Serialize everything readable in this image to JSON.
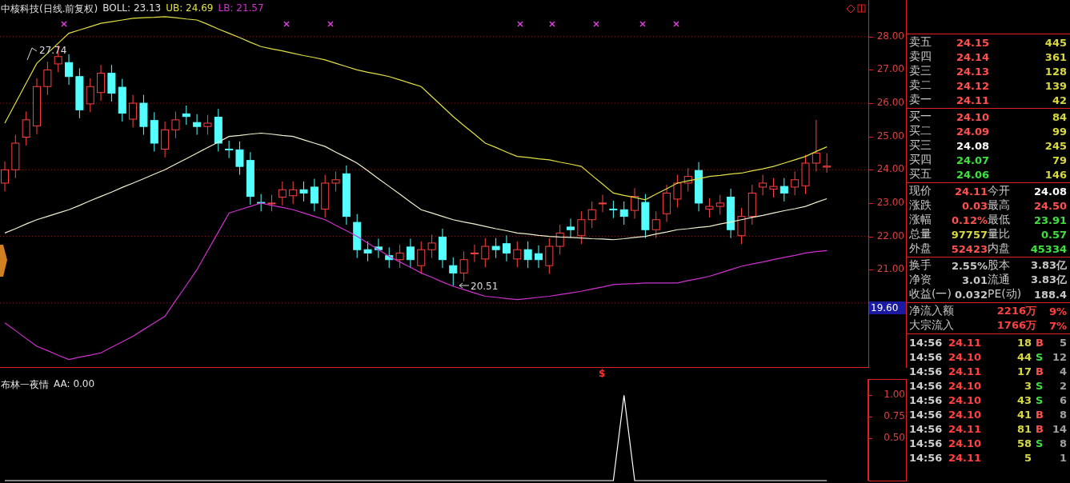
{
  "chart": {
    "stock": "中核科技(日线.前复权)",
    "boll": "BOLL: 23.13",
    "ub": "UB: 24.69",
    "lb": "LB: 21.57",
    "high_note": "27.74",
    "low_note": "20.51",
    "signal": "$",
    "chart_data": {
      "type": "candlestick",
      "ylim": [
        18.05,
        29.1
      ],
      "grid": true,
      "yticks": [
        {
          "value": 28,
          "label": "28.00"
        },
        {
          "value": 27,
          "label": "27.00"
        },
        {
          "value": 26,
          "label": "26.00"
        },
        {
          "value": 25,
          "label": "25.00"
        },
        {
          "value": 24,
          "label": "24.00"
        },
        {
          "value": 23,
          "label": "23.00"
        },
        {
          "value": 22,
          "label": "22.00"
        },
        {
          "value": 21,
          "label": "21.00"
        }
      ],
      "ohlc": [
        [
          23.6,
          24.25,
          23.35,
          24.0
        ],
        [
          24.0,
          25.05,
          23.75,
          24.8
        ],
        [
          24.98,
          25.75,
          24.73,
          25.5
        ],
        [
          25.32,
          26.75,
          25.07,
          26.5
        ],
        [
          26.5,
          27.25,
          26.25,
          27.0
        ],
        [
          27.18,
          27.74,
          26.93,
          27.4
        ],
        [
          27.22,
          27.47,
          26.55,
          26.8
        ],
        [
          26.8,
          27.05,
          25.55,
          25.8
        ],
        [
          25.98,
          26.75,
          25.73,
          26.5
        ],
        [
          26.32,
          27.15,
          26.07,
          26.9
        ],
        [
          26.9,
          27.15,
          26.05,
          26.3
        ],
        [
          26.48,
          26.73,
          25.45,
          25.7
        ],
        [
          25.52,
          26.25,
          25.27,
          26.0
        ],
        [
          26.0,
          26.25,
          25.05,
          25.3
        ],
        [
          25.48,
          25.73,
          24.55,
          24.8
        ],
        [
          24.62,
          25.45,
          24.37,
          25.2
        ],
        [
          25.2,
          25.75,
          24.95,
          25.5
        ],
        [
          25.68,
          25.93,
          25.35,
          25.6
        ],
        [
          25.42,
          25.67,
          25.05,
          25.3
        ],
        [
          25.3,
          25.65,
          25.05,
          25.4
        ],
        [
          25.58,
          25.83,
          24.55,
          24.8
        ],
        [
          24.62,
          24.87,
          24.35,
          24.6
        ],
        [
          24.6,
          24.85,
          23.85,
          24.1
        ],
        [
          24.28,
          24.53,
          22.95,
          23.2
        ],
        [
          23.02,
          23.27,
          22.75,
          23.0
        ],
        [
          23.0,
          23.25,
          22.75,
          23.0
        ],
        [
          23.18,
          23.65,
          22.93,
          23.4
        ],
        [
          23.22,
          23.65,
          22.97,
          23.4
        ],
        [
          23.4,
          23.65,
          23.05,
          23.3
        ],
        [
          23.48,
          23.73,
          22.75,
          23.0
        ],
        [
          22.82,
          23.85,
          22.57,
          23.6
        ],
        [
          23.6,
          23.95,
          23.35,
          23.7
        ],
        [
          23.88,
          24.13,
          22.35,
          22.6
        ],
        [
          22.42,
          22.67,
          21.35,
          21.6
        ],
        [
          21.6,
          21.85,
          21.25,
          21.5
        ],
        [
          21.68,
          21.93,
          21.35,
          21.6
        ],
        [
          21.42,
          21.67,
          21.05,
          21.3
        ],
        [
          21.3,
          21.75,
          21.05,
          21.5
        ],
        [
          21.68,
          21.93,
          21.05,
          21.3
        ],
        [
          21.12,
          21.85,
          20.87,
          21.6
        ],
        [
          21.6,
          22.05,
          21.35,
          21.8
        ],
        [
          21.98,
          22.23,
          21.05,
          21.3
        ],
        [
          21.12,
          21.37,
          20.51,
          20.9
        ],
        [
          20.9,
          21.55,
          20.65,
          21.3
        ],
        [
          21.48,
          21.75,
          21.23,
          21.5
        ],
        [
          21.32,
          21.95,
          21.07,
          21.7
        ],
        [
          21.7,
          21.95,
          21.35,
          21.6
        ],
        [
          21.78,
          22.03,
          21.25,
          21.5
        ],
        [
          21.32,
          21.85,
          21.07,
          21.6
        ],
        [
          21.6,
          21.85,
          21.05,
          21.3
        ],
        [
          21.48,
          21.73,
          21.05,
          21.3
        ],
        [
          21.12,
          21.95,
          20.87,
          21.7
        ],
        [
          21.7,
          22.35,
          21.45,
          22.1
        ],
        [
          22.28,
          22.53,
          21.95,
          22.2
        ],
        [
          22.02,
          22.75,
          21.77,
          22.5
        ],
        [
          22.5,
          23.05,
          22.25,
          22.8
        ],
        [
          22.98,
          23.25,
          22.73,
          23.0
        ],
        [
          22.82,
          23.07,
          22.55,
          22.8
        ],
        [
          22.8,
          23.05,
          22.35,
          22.6
        ],
        [
          22.78,
          23.45,
          22.53,
          23.2
        ],
        [
          23.02,
          23.27,
          21.95,
          22.2
        ],
        [
          22.2,
          22.75,
          21.95,
          22.5
        ],
        [
          22.68,
          23.55,
          22.43,
          23.3
        ],
        [
          23.12,
          23.85,
          22.87,
          23.6
        ],
        [
          23.6,
          24.05,
          23.35,
          23.8
        ],
        [
          23.98,
          24.23,
          22.75,
          23.0
        ],
        [
          22.82,
          23.15,
          22.57,
          22.9
        ],
        [
          22.9,
          23.25,
          22.65,
          23.0
        ],
        [
          23.18,
          23.43,
          21.95,
          22.2
        ],
        [
          22.02,
          22.85,
          21.77,
          22.6
        ],
        [
          22.6,
          23.55,
          22.35,
          23.3
        ],
        [
          23.48,
          23.85,
          23.23,
          23.6
        ],
        [
          23.42,
          23.75,
          23.17,
          23.5
        ],
        [
          23.5,
          23.75,
          23.05,
          23.3
        ],
        [
          23.48,
          23.95,
          23.23,
          23.7
        ],
        [
          23.52,
          24.45,
          23.27,
          24.2
        ],
        [
          24.2,
          25.5,
          23.95,
          24.5
        ],
        [
          24.08,
          24.5,
          23.91,
          24.11
        ]
      ],
      "series": [
        {
          "type": "line",
          "color": "#e0e040",
          "values": [
            25.4,
            26.0,
            26.6,
            27.2,
            27.5,
            27.8,
            28.1,
            28.2,
            28.3,
            28.4,
            28.45,
            28.5,
            28.55,
            28.57,
            28.58,
            28.6,
            28.57,
            28.53,
            28.5,
            28.37,
            28.23,
            28.1,
            27.97,
            27.83,
            27.7,
            27.63,
            27.57,
            27.5,
            27.43,
            27.37,
            27.3,
            27.2,
            27.1,
            27.0,
            26.93,
            26.87,
            26.8,
            26.7,
            26.6,
            26.5,
            26.2,
            25.9,
            25.6,
            25.33,
            25.07,
            24.8,
            24.67,
            24.53,
            24.4,
            24.37,
            24.33,
            24.3,
            24.23,
            24.17,
            24.1,
            23.83,
            23.57,
            23.3,
            23.23,
            23.17,
            23.1,
            23.27,
            23.43,
            23.6,
            23.67,
            23.73,
            23.8,
            23.83,
            23.87,
            23.9,
            23.97,
            24.03,
            24.1,
            24.2,
            24.3,
            24.4,
            24.55,
            24.69
          ]
        },
        {
          "type": "line",
          "color": "#f0f0d0",
          "values": [
            22.1,
            22.23,
            22.37,
            22.5,
            22.6,
            22.7,
            22.8,
            22.93,
            23.07,
            23.2,
            23.33,
            23.47,
            23.6,
            23.73,
            23.87,
            24.0,
            24.17,
            24.33,
            24.5,
            24.67,
            24.83,
            25.0,
            25.03,
            25.07,
            25.1,
            25.07,
            25.03,
            25.0,
            24.9,
            24.8,
            24.7,
            24.53,
            24.37,
            24.2,
            23.97,
            23.73,
            23.5,
            23.27,
            23.03,
            22.8,
            22.7,
            22.6,
            22.5,
            22.43,
            22.37,
            22.3,
            22.23,
            22.17,
            22.1,
            22.07,
            22.03,
            22.0,
            21.98,
            21.97,
            21.95,
            21.93,
            21.92,
            21.9,
            21.93,
            21.97,
            22.0,
            22.07,
            22.13,
            22.2,
            22.23,
            22.27,
            22.3,
            22.37,
            22.43,
            22.5,
            22.57,
            22.63,
            22.7,
            22.77,
            22.83,
            22.9,
            23.02,
            23.13
          ]
        },
        {
          "type": "line",
          "color": "#d030d0",
          "values": [
            19.4,
            19.17,
            18.93,
            18.7,
            18.57,
            18.43,
            18.3,
            18.37,
            18.43,
            18.5,
            18.67,
            18.83,
            19.0,
            19.2,
            19.4,
            19.6,
            20.07,
            20.53,
            21.0,
            21.57,
            22.13,
            22.7,
            22.8,
            22.9,
            23.0,
            22.93,
            22.87,
            22.8,
            22.7,
            22.6,
            22.5,
            22.33,
            22.17,
            22.0,
            21.8,
            21.6,
            21.4,
            21.23,
            21.07,
            20.9,
            20.77,
            20.63,
            20.5,
            20.4,
            20.3,
            20.2,
            20.17,
            20.13,
            20.1,
            20.13,
            20.17,
            20.2,
            20.25,
            20.3,
            20.35,
            20.42,
            20.48,
            20.55,
            20.57,
            20.58,
            20.6,
            20.6,
            20.6,
            20.6,
            20.67,
            20.73,
            20.8,
            20.9,
            21.0,
            21.1,
            21.17,
            21.23,
            21.3,
            21.37,
            21.43,
            21.5,
            21.54,
            21.57
          ]
        }
      ]
    }
  },
  "price_axis": {
    "cursor_value": "19.60"
  },
  "indicator_panel": {
    "title": "布林一夜情",
    "reading": "AA: 0.00",
    "chart_data": {
      "type": "line",
      "ylim": [
        0,
        1.19
      ],
      "yticks": [
        {
          "value": 1,
          "label": "1.00"
        },
        {
          "value": 0.75,
          "label": "0.75"
        },
        {
          "value": 0.5,
          "label": "0.50"
        }
      ],
      "series": [
        {
          "color": "#ffffff",
          "values": [
            0,
            0,
            0,
            0,
            0,
            0,
            0,
            0,
            0,
            0,
            0,
            0,
            0,
            0,
            0,
            0,
            0,
            0,
            0,
            0,
            0,
            0,
            0,
            0,
            0,
            0,
            0,
            0,
            0,
            0,
            0,
            0,
            0,
            0,
            0,
            0,
            0,
            0,
            0,
            0,
            0,
            0,
            0,
            0,
            0,
            0,
            0,
            0,
            0,
            0,
            0,
            0,
            0,
            0,
            0,
            0,
            0,
            0,
            1,
            0,
            0,
            0,
            0,
            0,
            0,
            0,
            0,
            0,
            0,
            0,
            0,
            0,
            0,
            0,
            0,
            0,
            0,
            0
          ]
        }
      ]
    }
  },
  "order_book": {
    "asks": [
      {
        "label": "卖五",
        "price": "24.15",
        "color": "#ff5050",
        "volume": "445"
      },
      {
        "label": "卖四",
        "price": "24.14",
        "color": "#ff5050",
        "volume": "361"
      },
      {
        "label": "卖三",
        "price": "24.13",
        "color": "#ff5050",
        "volume": "128"
      },
      {
        "label": "卖二",
        "price": "24.12",
        "color": "#ff5050",
        "volume": "139"
      },
      {
        "label": "卖一",
        "price": "24.11",
        "color": "#ff5050",
        "volume": "42"
      }
    ],
    "bids": [
      {
        "label": "买一",
        "price": "24.10",
        "color": "#ff5050",
        "volume": "84"
      },
      {
        "label": "买二",
        "price": "24.09",
        "color": "#ff5050",
        "volume": "99"
      },
      {
        "label": "买三",
        "price": "24.08",
        "color": "#ffffff",
        "volume": "245"
      },
      {
        "label": "买四",
        "price": "24.07",
        "color": "#40e040",
        "volume": "79"
      },
      {
        "label": "买五",
        "price": "24.06",
        "color": "#40e040",
        "volume": "146"
      }
    ]
  },
  "quote": [
    {
      "cells": [
        {
          "label": "现价",
          "value": "24.11",
          "color": "#ff5050"
        },
        {
          "label": "今开",
          "value": "24.08",
          "color": "#ffffff"
        }
      ]
    },
    {
      "cells": [
        {
          "label": "涨跌",
          "value": "0.03",
          "color": "#ff5050"
        },
        {
          "label": "最高",
          "value": "24.50",
          "color": "#ff5050"
        }
      ]
    },
    {
      "cells": [
        {
          "label": "涨幅",
          "value": "0.12%",
          "color": "#ff5050"
        },
        {
          "label": "最低",
          "value": "23.91",
          "color": "#40e040"
        }
      ]
    },
    {
      "cells": [
        {
          "label": "总量",
          "value": "97757",
          "color": "#d8d840"
        },
        {
          "label": "量比",
          "value": "0.57",
          "color": "#40e040"
        }
      ]
    },
    {
      "cells": [
        {
          "label": "外盘",
          "value": "52423",
          "color": "#ff5050"
        },
        {
          "label": "内盘",
          "value": "45334",
          "color": "#40e040"
        }
      ]
    }
  ],
  "stats": [
    {
      "cells": [
        {
          "label": "换手",
          "value": "2.55%"
        },
        {
          "label": "股本",
          "value": "3.83亿"
        }
      ]
    },
    {
      "cells": [
        {
          "label": "净资",
          "value": "3.01"
        },
        {
          "label": "流通",
          "value": "3.83亿"
        }
      ]
    },
    {
      "cells": [
        {
          "label": "收益(一)",
          "value": "0.032"
        },
        {
          "label": "PE(动)",
          "value": "188.4"
        }
      ]
    }
  ],
  "flow": [
    {
      "label": "净流入额",
      "amount": "2216万",
      "percent": "9%"
    },
    {
      "label": "大宗流入",
      "amount": "1766万",
      "percent": "7%"
    }
  ],
  "ticks": [
    {
      "time": "14:56",
      "price": "24.11",
      "volume": "18",
      "side": "B",
      "kind": "buy",
      "count": "5"
    },
    {
      "time": "14:56",
      "price": "24.10",
      "volume": "44",
      "side": "S",
      "kind": "sell",
      "count": "12"
    },
    {
      "time": "14:56",
      "price": "24.11",
      "volume": "17",
      "side": "B",
      "kind": "buy",
      "count": "4"
    },
    {
      "time": "14:56",
      "price": "24.10",
      "volume": "3",
      "side": "S",
      "kind": "sell",
      "count": "2"
    },
    {
      "time": "14:56",
      "price": "24.10",
      "volume": "43",
      "side": "S",
      "kind": "sell",
      "count": "6"
    },
    {
      "time": "14:56",
      "price": "24.10",
      "volume": "41",
      "side": "B",
      "kind": "buy",
      "count": "8"
    },
    {
      "time": "14:56",
      "price": "24.11",
      "volume": "81",
      "side": "B",
      "kind": "buy",
      "count": "14"
    },
    {
      "time": "14:56",
      "price": "24.10",
      "volume": "58",
      "side": "S",
      "kind": "sell",
      "count": "8"
    },
    {
      "time": "14:56",
      "price": "24.11",
      "volume": "5",
      "count": "1"
    }
  ]
}
